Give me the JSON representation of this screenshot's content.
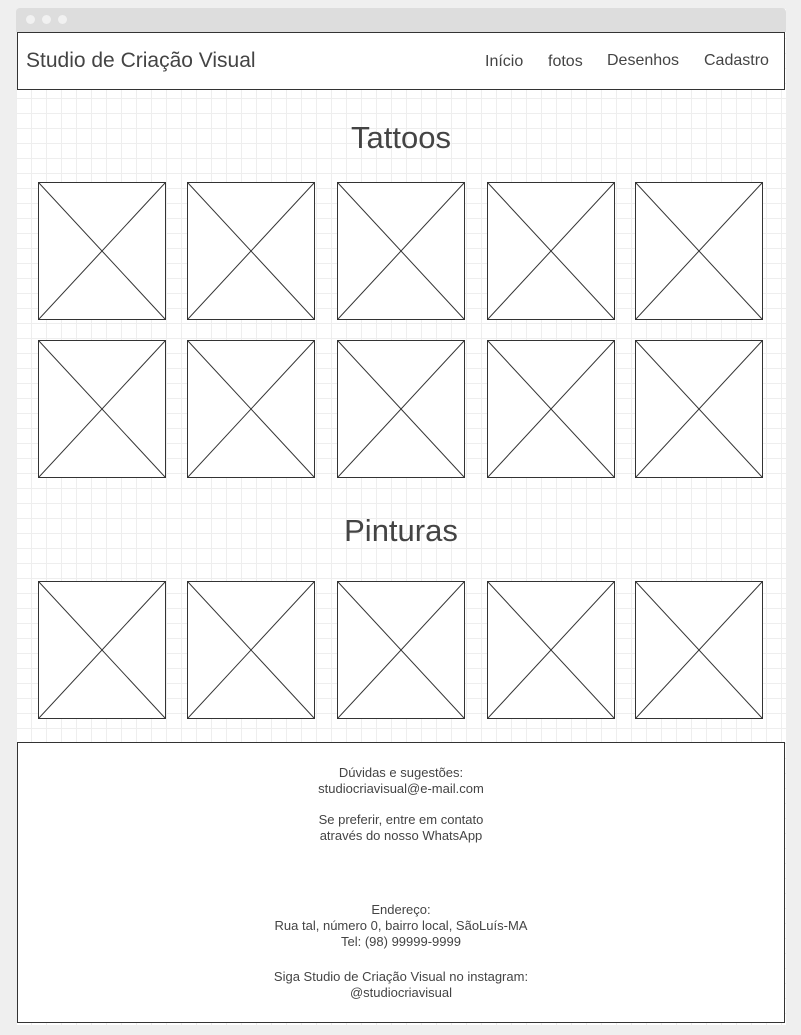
{
  "navbar": {
    "brand": "Studio de Criação Visual",
    "links": [
      "Início",
      "fotos",
      "Desenhos",
      "Cadastro"
    ]
  },
  "sections": {
    "tattoos_title": "Tattoos",
    "pinturas_title": "Pinturas"
  },
  "footer": {
    "doubts_label": "Dúvidas e sugestões:",
    "email": "studiocriavisual@e-mail.com",
    "whatsapp_line1": "Se preferir, entre em contato",
    "whatsapp_line2": "através do nosso WhatsApp",
    "address_label": "Endereço:",
    "address": "Rua tal, número 0, bairro local, SãoLuís-MA",
    "phone": "Tel: (98) 99999-9999",
    "instagram_line": "Siga Studio de Criação Visual no instagram:",
    "instagram_handle": "@studiocriavisual"
  },
  "colors": {
    "border": "#333333",
    "text": "#444444",
    "grid": "#eeeeee",
    "titlebar": "#dddddd"
  },
  "icons": {
    "image_placeholder": "image-placeholder-icon"
  }
}
